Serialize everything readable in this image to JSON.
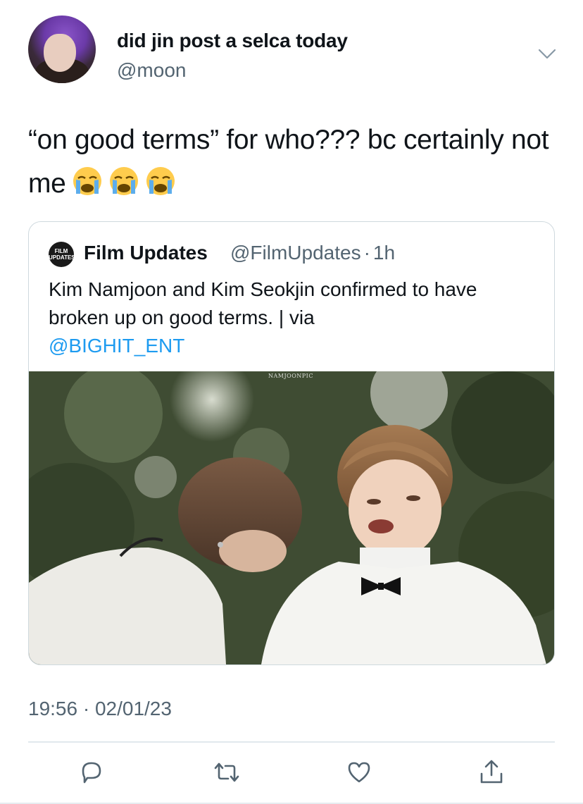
{
  "tweet": {
    "author_name": "did jin post a selca today",
    "author_handle": "@moon",
    "text": "“on good terms” for who??? bc certainly not me",
    "emojis": [
      "loudly-crying-face",
      "loudly-crying-face",
      "loudly-crying-face"
    ],
    "timestamp": "19:56 · 02/01/23"
  },
  "quote": {
    "avatar_text": "FILM UPDATES",
    "author_name": "Film Updates",
    "author_handle": "@FilmUpdates",
    "separator": "·",
    "time": "1h",
    "text": "Kim Namjoon and Kim Seokjin confirmed to have broken up on good terms. | via",
    "mention": "@BIGHIT_ENT",
    "media_watermark": "NAMJOONPIC"
  },
  "actions": [
    {
      "icon": "reply-icon"
    },
    {
      "icon": "retweet-icon"
    },
    {
      "icon": "like-icon"
    },
    {
      "icon": "share-icon"
    }
  ],
  "colors": {
    "text": "#0f1419",
    "secondary": "#536471",
    "link": "#1d9bf0",
    "border": "#cfd9de"
  }
}
